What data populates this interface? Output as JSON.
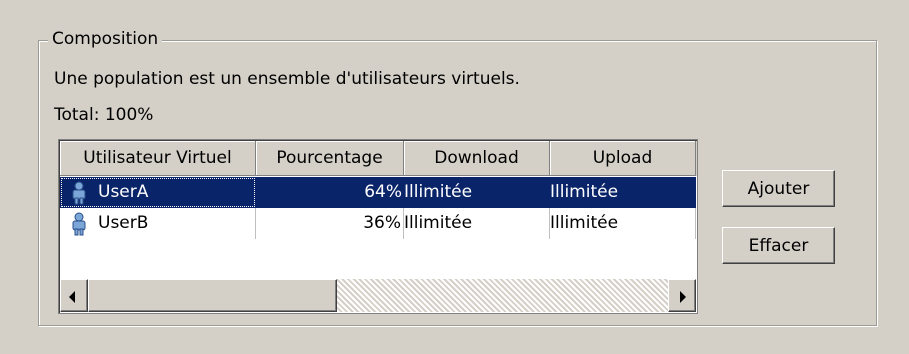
{
  "group": {
    "title": "Composition"
  },
  "description": "Une population est un ensemble d'utilisateurs virtuels.",
  "total": "Total: 100%",
  "table": {
    "columns": [
      "Utilisateur Virtuel",
      "Pourcentage",
      "Download",
      "Upload"
    ],
    "rows": [
      {
        "user": "UserA",
        "percent": "64%",
        "download": "Illimitée",
        "upload": "Illimitée",
        "selected": true
      },
      {
        "user": "UserB",
        "percent": "36%",
        "download": "Illimitée",
        "upload": "Illimitée",
        "selected": false
      }
    ]
  },
  "buttons": {
    "add": "Ajouter",
    "clear": "Effacer"
  },
  "icons": {
    "row_icon": "user-icon",
    "scroll_left": "left-arrow-icon",
    "scroll_right": "right-arrow-icon"
  },
  "colors": {
    "selection": "#0a246a",
    "window": "#d4d0c8"
  }
}
